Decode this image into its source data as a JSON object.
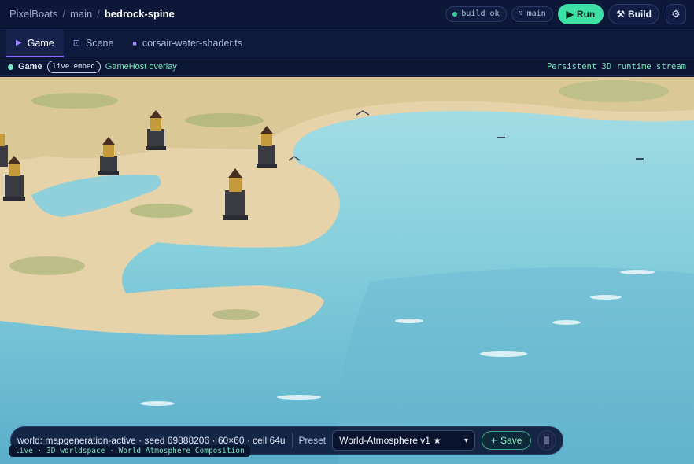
{
  "breadcrumb": {
    "org": "PixelBoats",
    "sep1": "/",
    "branch": "main",
    "sep2": "/",
    "project": "bedrock-spine"
  },
  "header": {
    "build_status": "build ok",
    "branch_pill": "main",
    "branch_icon": "git-branch-icon",
    "run_label": "Run",
    "run_icon": "play-icon",
    "build_label": "Build",
    "build_icon": "hammer-icon",
    "settings_icon": "gear-icon"
  },
  "tabs": [
    {
      "label": "Game",
      "icon": "play-icon",
      "active": true
    },
    {
      "label": "Scene",
      "icon": "scene-icon",
      "active": false
    },
    {
      "label": "corsair-water-shader.ts",
      "icon": "file-icon",
      "active": false
    }
  ],
  "overlay": {
    "title": "Game",
    "badge": "live embed",
    "host": "GameHost overlay",
    "right": "Persistent 3D runtime stream"
  },
  "hud": {
    "status": "world: mapgeneration-active · seed 69888206 · 60×60 · cell 64u",
    "preset_label": "Preset",
    "preset_value": "World-Atmosphere v1 ★",
    "save_label": "Save",
    "save_icon": "plus-icon",
    "caption": "live · 3D worldspace · World Atmosphere Composition"
  },
  "colors": {
    "accent": "#3ee0a6",
    "tab_underline": "#8a6cff",
    "background": "#0b1533",
    "water": "#8fd3dd",
    "sand": "#e9d7b0"
  }
}
